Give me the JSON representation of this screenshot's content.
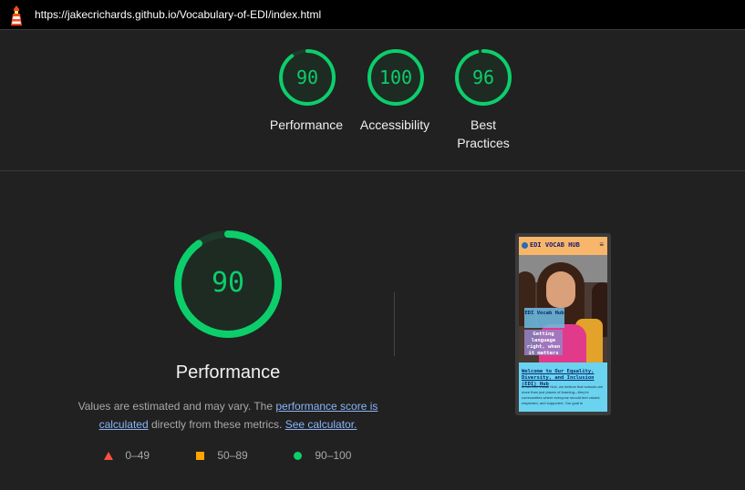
{
  "browser": {
    "url": "https://jakecrichards.github.io/Vocabulary-of-EDI/index.html"
  },
  "summary_gauges": [
    {
      "score": 90,
      "label": "Performance"
    },
    {
      "score": 100,
      "label": "Accessibility"
    },
    {
      "score": 96,
      "label": "Best Practices"
    }
  ],
  "performance": {
    "score": 90,
    "title": "Performance",
    "desc_prefix": "Values are estimated and may vary. The ",
    "link_score": "performance score is calculated",
    "desc_middle": " directly from these metrics. ",
    "link_calculator": "See calculator."
  },
  "legend": [
    {
      "range": "0–49",
      "color": "#ff4e42",
      "shape": "triangle"
    },
    {
      "range": "50–89",
      "color": "#ffa400",
      "shape": "square"
    },
    {
      "range": "90–100",
      "color": "#0cce6b",
      "shape": "circle"
    }
  ],
  "thumbnail": {
    "brand": "EDI VOCAB HUB",
    "caption_1": "EDI Vocab Hub",
    "caption_2": "Getting language right, when it matters",
    "welcome": "Welcome to Our Equality, Diversity, and Inclusion (EDI) Hub",
    "body": "In our EDI Vocab Hub, we believe that schools are more than just places of learning—they're communities where everyone should feel valued, respected, and supported. Our goal is"
  },
  "colors": {
    "good": "#0cce6b",
    "average": "#ffa400",
    "fail": "#ff4e42",
    "background": "#212121"
  }
}
